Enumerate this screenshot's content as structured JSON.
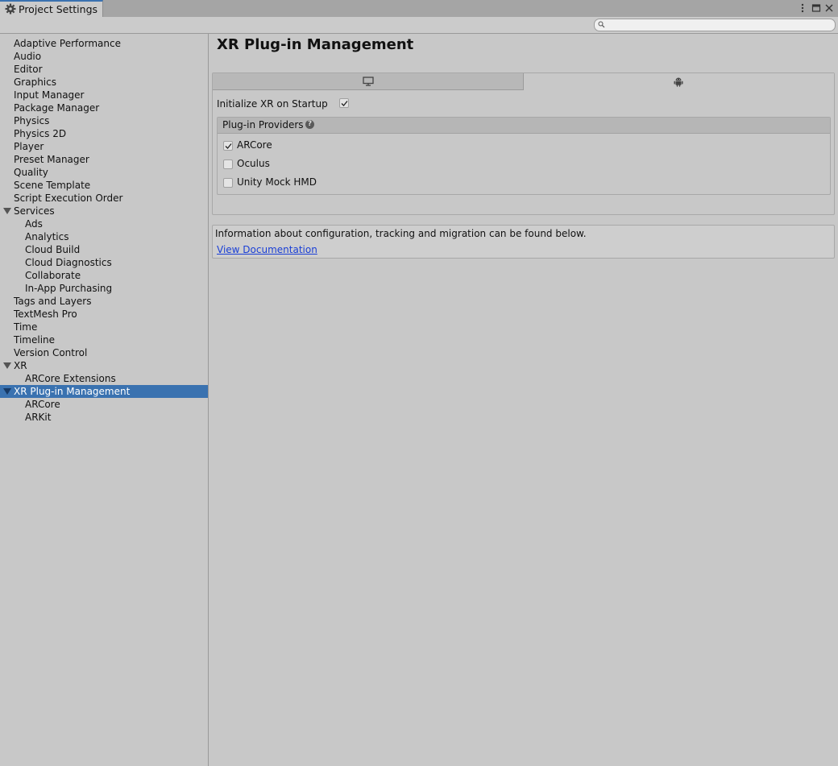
{
  "window": {
    "tab_title": "Project Settings",
    "tab_icon": "gear-icon",
    "controls": [
      "more-vertical-icon",
      "maximize-icon",
      "close-icon"
    ]
  },
  "search": {
    "placeholder": "",
    "value": ""
  },
  "sidebar": {
    "items": [
      {
        "label": "Adaptive Performance"
      },
      {
        "label": "Audio"
      },
      {
        "label": "Editor"
      },
      {
        "label": "Graphics"
      },
      {
        "label": "Input Manager"
      },
      {
        "label": "Package Manager"
      },
      {
        "label": "Physics"
      },
      {
        "label": "Physics 2D"
      },
      {
        "label": "Player"
      },
      {
        "label": "Preset Manager"
      },
      {
        "label": "Quality"
      },
      {
        "label": "Scene Template"
      },
      {
        "label": "Script Execution Order"
      },
      {
        "label": "Services",
        "expanded": true
      },
      {
        "label": "Ads"
      },
      {
        "label": "Analytics"
      },
      {
        "label": "Cloud Build"
      },
      {
        "label": "Cloud Diagnostics"
      },
      {
        "label": "Collaborate"
      },
      {
        "label": "In-App Purchasing"
      },
      {
        "label": "Tags and Layers"
      },
      {
        "label": "TextMesh Pro"
      },
      {
        "label": "Time"
      },
      {
        "label": "Timeline"
      },
      {
        "label": "Version Control"
      },
      {
        "label": "XR",
        "expanded": true
      },
      {
        "label": "ARCore Extensions"
      },
      {
        "label": "XR Plug-in Management",
        "expanded": true,
        "selected": true
      },
      {
        "label": "ARCore"
      },
      {
        "label": "ARKit"
      }
    ]
  },
  "main": {
    "title": "XR Plug-in Management",
    "platform_tabs": [
      {
        "icon": "desktop-icon",
        "selected": false
      },
      {
        "icon": "android-icon",
        "selected": true
      }
    ],
    "init_on_startup": {
      "label": "Initialize XR on Startup",
      "checked": true
    },
    "providers": {
      "header": "Plug-in Providers",
      "items": [
        {
          "label": "ARCore",
          "checked": true
        },
        {
          "label": "Oculus",
          "checked": false
        },
        {
          "label": "Unity Mock HMD",
          "checked": false
        }
      ]
    },
    "info": {
      "text": "Information about configuration, tracking and migration can be found below.",
      "link": "View Documentation"
    }
  },
  "colors": {
    "selection": "#3a72b0",
    "link": "#1a3fd6",
    "background": "#c8c8c8"
  }
}
